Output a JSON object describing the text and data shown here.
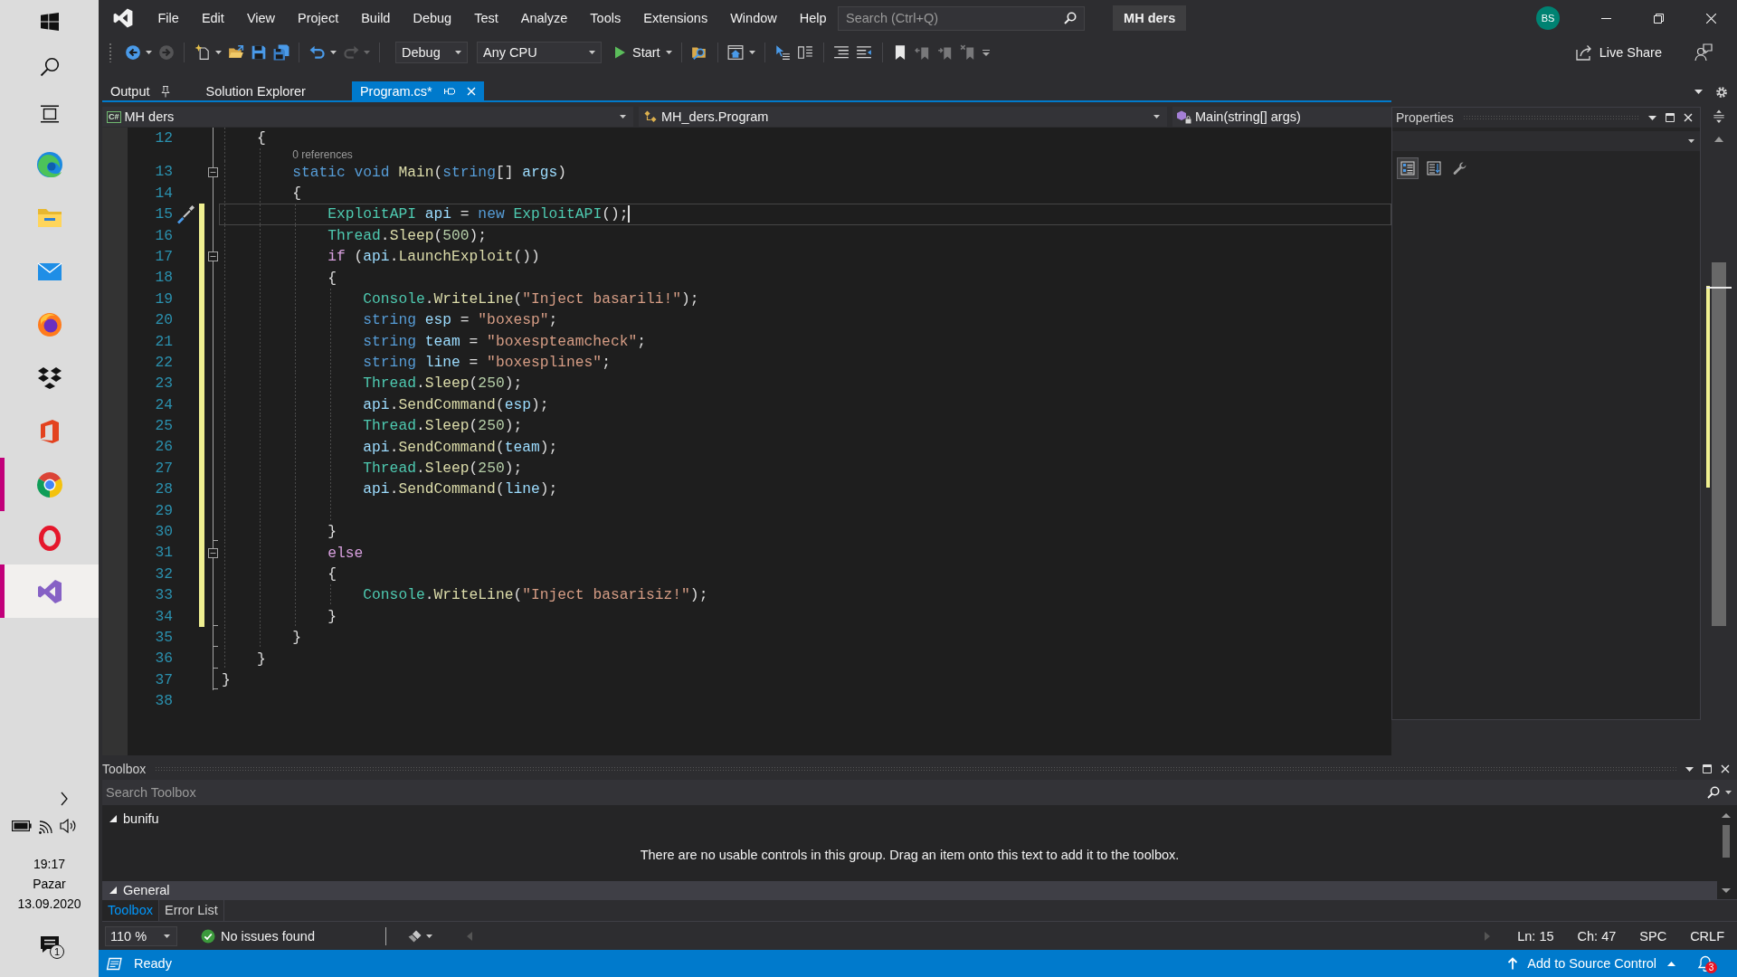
{
  "taskbar": {
    "buttons": [
      {
        "kind": "start"
      },
      {
        "kind": "search"
      },
      {
        "kind": "task_view"
      }
    ],
    "apps": [
      {
        "kind": "swirl",
        "running": false,
        "selected": false
      },
      {
        "kind": "folder",
        "running": false,
        "selected": false
      },
      {
        "kind": "envelope",
        "running": false,
        "selected": false
      },
      {
        "kind": "fox",
        "running": false,
        "selected": false
      },
      {
        "kind": "diamonds",
        "running": false,
        "selected": false
      },
      {
        "kind": "office",
        "running": false,
        "selected": false
      },
      {
        "kind": "ring",
        "running": true,
        "selected": false
      },
      {
        "kind": "oval",
        "running": false,
        "selected": false
      },
      {
        "kind": "ribbon",
        "running": true,
        "selected": true
      }
    ],
    "clock": {
      "time": "19:17",
      "day": "Pazar",
      "date": "13.09.2020"
    },
    "notifications": {
      "count": "1"
    }
  },
  "window": {
    "menu": [
      "File",
      "Edit",
      "View",
      "Project",
      "Build",
      "Debug",
      "Test",
      "Analyze",
      "Tools",
      "Extensions",
      "Window",
      "Help"
    ],
    "search": {
      "placeholder": "Search (Ctrl+Q)"
    },
    "title": "MH ders",
    "account": {
      "initials": "BS"
    }
  },
  "toolbar": {
    "items": [
      {
        "kind": "back",
        "disabled": false,
        "menu": true
      },
      {
        "kind": "forward",
        "disabled": true,
        "menu": false
      },
      {
        "kind": "separator"
      },
      {
        "kind": "new_project",
        "disabled": false,
        "menu": true
      },
      {
        "kind": "open",
        "disabled": false,
        "menu": false
      },
      {
        "kind": "save",
        "disabled": false,
        "menu": false
      },
      {
        "kind": "save_all",
        "disabled": false,
        "menu": false
      },
      {
        "kind": "separator"
      },
      {
        "kind": "undo",
        "disabled": false,
        "menu": true
      },
      {
        "kind": "redo",
        "disabled": true,
        "menu": true
      },
      {
        "kind": "separator"
      },
      {
        "kind": "configuration",
        "text": "Debug"
      },
      {
        "kind": "platform",
        "text": "Any CPU"
      },
      {
        "kind": "start",
        "text": "Start",
        "menu": true
      },
      {
        "kind": "separator"
      },
      {
        "kind": "find_files",
        "disabled": false,
        "menu": false
      },
      {
        "kind": "separator"
      },
      {
        "kind": "browser_link",
        "disabled": false,
        "menu": true
      },
      {
        "kind": "separator"
      },
      {
        "kind": "arrow_list",
        "disabled": false,
        "menu": false
      },
      {
        "kind": "panels",
        "disabled": false,
        "menu": false
      },
      {
        "kind": "separator"
      },
      {
        "kind": "comment",
        "disabled": false,
        "menu": false
      },
      {
        "kind": "uncomment",
        "disabled": false,
        "menu": false
      },
      {
        "kind": "separator"
      },
      {
        "kind": "bookmark",
        "disabled": false,
        "menu": false
      },
      {
        "kind": "prev_bookmark",
        "disabled": true,
        "menu": false
      },
      {
        "kind": "next_bookmark",
        "disabled": true,
        "menu": false
      },
      {
        "kind": "clear_bookmarks",
        "disabled": true,
        "menu": false
      },
      {
        "kind": "overflow"
      }
    ],
    "live_share": "Live Share"
  },
  "document_tabs": [
    {
      "label": "Output",
      "selected": false,
      "pinned": true
    },
    {
      "label": "Solution Explorer",
      "selected": false,
      "pinned": false
    },
    {
      "label": "Program.cs*",
      "selected": true,
      "pinned": false
    }
  ],
  "navigation": [
    {
      "kind": "project",
      "badge": "C#",
      "text": "MH ders"
    },
    {
      "kind": "type",
      "text": "MH_ders.Program"
    },
    {
      "kind": "member",
      "text": "Main(string[] args)"
    }
  ],
  "editor": {
    "lines": [
      {
        "number": "12",
        "changed": false,
        "current": false,
        "tokens": [
          {
            "text": "    {",
            "kind": "punctuation"
          }
        ]
      },
      {
        "number": "13",
        "changed": false,
        "current": false,
        "codelens": "0 references",
        "fold": {
          "kind": "start",
          "expanded": true
        },
        "tokens": [
          {
            "text": "        static",
            "kind": "keyword"
          },
          {
            "text": " void",
            "kind": "keyword"
          },
          {
            "text": " Main",
            "kind": "method"
          },
          {
            "text": "(",
            "kind": "punctuation"
          },
          {
            "text": "string",
            "kind": "keyword"
          },
          {
            "text": "[] ",
            "kind": "punctuation"
          },
          {
            "text": "args",
            "kind": "variable"
          },
          {
            "text": ")",
            "kind": "punctuation"
          }
        ]
      },
      {
        "number": "14",
        "changed": false,
        "current": false,
        "tokens": [
          {
            "text": "        {",
            "kind": "punctuation"
          }
        ]
      },
      {
        "number": "15",
        "changed": true,
        "current": true,
        "tokens": [
          {
            "text": "            ExploitAPI",
            "kind": "type"
          },
          {
            "text": " api",
            "kind": "variable"
          },
          {
            "text": " = ",
            "kind": "punctuation"
          },
          {
            "text": "new",
            "kind": "keyword"
          },
          {
            "text": " ExploitAPI",
            "kind": "type"
          },
          {
            "text": "();",
            "kind": "punctuation"
          }
        ]
      },
      {
        "number": "16",
        "changed": true,
        "current": false,
        "tokens": [
          {
            "text": "            Thread",
            "kind": "type"
          },
          {
            "text": ".",
            "kind": "punctuation"
          },
          {
            "text": "Sleep",
            "kind": "method"
          },
          {
            "text": "(",
            "kind": "punctuation"
          },
          {
            "text": "500",
            "kind": "number"
          },
          {
            "text": ");",
            "kind": "punctuation"
          }
        ]
      },
      {
        "number": "17",
        "changed": true,
        "current": false,
        "fold": {
          "kind": "start",
          "expanded": true
        },
        "tokens": [
          {
            "text": "            if",
            "kind": "control"
          },
          {
            "text": " (",
            "kind": "punctuation"
          },
          {
            "text": "api",
            "kind": "variable"
          },
          {
            "text": ".",
            "kind": "punctuation"
          },
          {
            "text": "LaunchExploit",
            "kind": "method"
          },
          {
            "text": "())",
            "kind": "punctuation"
          }
        ]
      },
      {
        "number": "18",
        "changed": true,
        "current": false,
        "tokens": [
          {
            "text": "            {",
            "kind": "punctuation"
          }
        ]
      },
      {
        "number": "19",
        "changed": true,
        "current": false,
        "tokens": [
          {
            "text": "                Console",
            "kind": "type"
          },
          {
            "text": ".",
            "kind": "punctuation"
          },
          {
            "text": "WriteLine",
            "kind": "method"
          },
          {
            "text": "(",
            "kind": "punctuation"
          },
          {
            "text": "\"Inject basarili!\"",
            "kind": "string"
          },
          {
            "text": ");",
            "kind": "punctuation"
          }
        ]
      },
      {
        "number": "20",
        "changed": true,
        "current": false,
        "tokens": [
          {
            "text": "                string",
            "kind": "keyword"
          },
          {
            "text": " esp",
            "kind": "variable"
          },
          {
            "text": " = ",
            "kind": "punctuation"
          },
          {
            "text": "\"boxesp\"",
            "kind": "string"
          },
          {
            "text": ";",
            "kind": "punctuation"
          }
        ]
      },
      {
        "number": "21",
        "changed": true,
        "current": false,
        "tokens": [
          {
            "text": "                string",
            "kind": "keyword"
          },
          {
            "text": " team",
            "kind": "variable"
          },
          {
            "text": " = ",
            "kind": "punctuation"
          },
          {
            "text": "\"boxespteamcheck\"",
            "kind": "string"
          },
          {
            "text": ";",
            "kind": "punctuation"
          }
        ]
      },
      {
        "number": "22",
        "changed": true,
        "current": false,
        "tokens": [
          {
            "text": "                string",
            "kind": "keyword"
          },
          {
            "text": " line",
            "kind": "variable"
          },
          {
            "text": " = ",
            "kind": "punctuation"
          },
          {
            "text": "\"boxesplines\"",
            "kind": "string"
          },
          {
            "text": ";",
            "kind": "punctuation"
          }
        ]
      },
      {
        "number": "23",
        "changed": true,
        "current": false,
        "tokens": [
          {
            "text": "                Thread",
            "kind": "type"
          },
          {
            "text": ".",
            "kind": "punctuation"
          },
          {
            "text": "Sleep",
            "kind": "method"
          },
          {
            "text": "(",
            "kind": "punctuation"
          },
          {
            "text": "250",
            "kind": "number"
          },
          {
            "text": ");",
            "kind": "punctuation"
          }
        ]
      },
      {
        "number": "24",
        "changed": true,
        "current": false,
        "tokens": [
          {
            "text": "                api",
            "kind": "variable"
          },
          {
            "text": ".",
            "kind": "punctuation"
          },
          {
            "text": "SendCommand",
            "kind": "method"
          },
          {
            "text": "(",
            "kind": "punctuation"
          },
          {
            "text": "esp",
            "kind": "variable"
          },
          {
            "text": ");",
            "kind": "punctuation"
          }
        ]
      },
      {
        "number": "25",
        "changed": true,
        "current": false,
        "tokens": [
          {
            "text": "                Thread",
            "kind": "type"
          },
          {
            "text": ".",
            "kind": "punctuation"
          },
          {
            "text": "Sleep",
            "kind": "method"
          },
          {
            "text": "(",
            "kind": "punctuation"
          },
          {
            "text": "250",
            "kind": "number"
          },
          {
            "text": ");",
            "kind": "punctuation"
          }
        ]
      },
      {
        "number": "26",
        "changed": true,
        "current": false,
        "tokens": [
          {
            "text": "                api",
            "kind": "variable"
          },
          {
            "text": ".",
            "kind": "punctuation"
          },
          {
            "text": "SendCommand",
            "kind": "method"
          },
          {
            "text": "(",
            "kind": "punctuation"
          },
          {
            "text": "team",
            "kind": "variable"
          },
          {
            "text": ");",
            "kind": "punctuation"
          }
        ]
      },
      {
        "number": "27",
        "changed": true,
        "current": false,
        "tokens": [
          {
            "text": "                Thread",
            "kind": "type"
          },
          {
            "text": ".",
            "kind": "punctuation"
          },
          {
            "text": "Sleep",
            "kind": "method"
          },
          {
            "text": "(",
            "kind": "punctuation"
          },
          {
            "text": "250",
            "kind": "number"
          },
          {
            "text": ");",
            "kind": "punctuation"
          }
        ]
      },
      {
        "number": "28",
        "changed": true,
        "current": false,
        "tokens": [
          {
            "text": "                api",
            "kind": "variable"
          },
          {
            "text": ".",
            "kind": "punctuation"
          },
          {
            "text": "SendCommand",
            "kind": "method"
          },
          {
            "text": "(",
            "kind": "punctuation"
          },
          {
            "text": "line",
            "kind": "variable"
          },
          {
            "text": ");",
            "kind": "punctuation"
          }
        ]
      },
      {
        "number": "29",
        "changed": true,
        "current": false
      },
      {
        "number": "30",
        "changed": true,
        "current": false,
        "fold": {
          "kind": "end"
        },
        "tokens": [
          {
            "text": "            }",
            "kind": "punctuation"
          }
        ]
      },
      {
        "number": "31",
        "changed": true,
        "current": false,
        "fold": {
          "kind": "start",
          "expanded": true
        },
        "tokens": [
          {
            "text": "            else",
            "kind": "control"
          }
        ]
      },
      {
        "number": "32",
        "changed": true,
        "current": false,
        "tokens": [
          {
            "text": "            {",
            "kind": "punctuation"
          }
        ]
      },
      {
        "number": "33",
        "changed": true,
        "current": false,
        "tokens": [
          {
            "text": "                Console",
            "kind": "type"
          },
          {
            "text": ".",
            "kind": "punctuation"
          },
          {
            "text": "WriteLine",
            "kind": "method"
          },
          {
            "text": "(",
            "kind": "punctuation"
          },
          {
            "text": "\"Inject basarisiz!\"",
            "kind": "string"
          },
          {
            "text": ");",
            "kind": "punctuation"
          }
        ]
      },
      {
        "number": "34",
        "changed": true,
        "current": false,
        "fold": {
          "kind": "end"
        },
        "tokens": [
          {
            "text": "            }",
            "kind": "punctuation"
          }
        ]
      },
      {
        "number": "35",
        "changed": false,
        "current": false,
        "fold": {
          "kind": "end"
        },
        "tokens": [
          {
            "text": "        }",
            "kind": "punctuation"
          }
        ]
      },
      {
        "number": "36",
        "changed": false,
        "current": false,
        "fold": {
          "kind": "end"
        },
        "tokens": [
          {
            "text": "    }",
            "kind": "punctuation"
          }
        ]
      },
      {
        "number": "37",
        "changed": false,
        "current": false,
        "fold": {
          "kind": "end"
        },
        "tokens": [
          {
            "text": "}",
            "kind": "punctuation"
          }
        ]
      },
      {
        "number": "38",
        "changed": false,
        "current": false
      }
    ]
  },
  "properties": {
    "title": "Properties",
    "tools": [
      {
        "kind": "categorized",
        "selected": true
      },
      {
        "kind": "alphabetical",
        "selected": false
      },
      {
        "kind": "property_pages",
        "selected": false
      }
    ]
  },
  "toolbox": {
    "title": "Toolbox",
    "search": {
      "placeholder": "Search Toolbox"
    },
    "groups": [
      {
        "name": "bunifu",
        "expanded": true,
        "selected": false,
        "message": "There are no usable controls in this group. Drag an item onto this text to add it to the toolbox."
      },
      {
        "name": "General",
        "expanded": true,
        "selected": true
      }
    ]
  },
  "bottom_tabs": [
    {
      "label": "Toolbox",
      "selected": true
    },
    {
      "label": "Error List",
      "selected": false
    }
  ],
  "editor_status": {
    "zoom": "110 %",
    "issues": "No issues found",
    "line": "Ln: 15",
    "column": "Ch: 47",
    "indent": "SPC",
    "line_ending": "CRLF"
  },
  "status_bar": {
    "text": "Ready",
    "source_control": "Add to Source Control",
    "notifications": "3"
  }
}
